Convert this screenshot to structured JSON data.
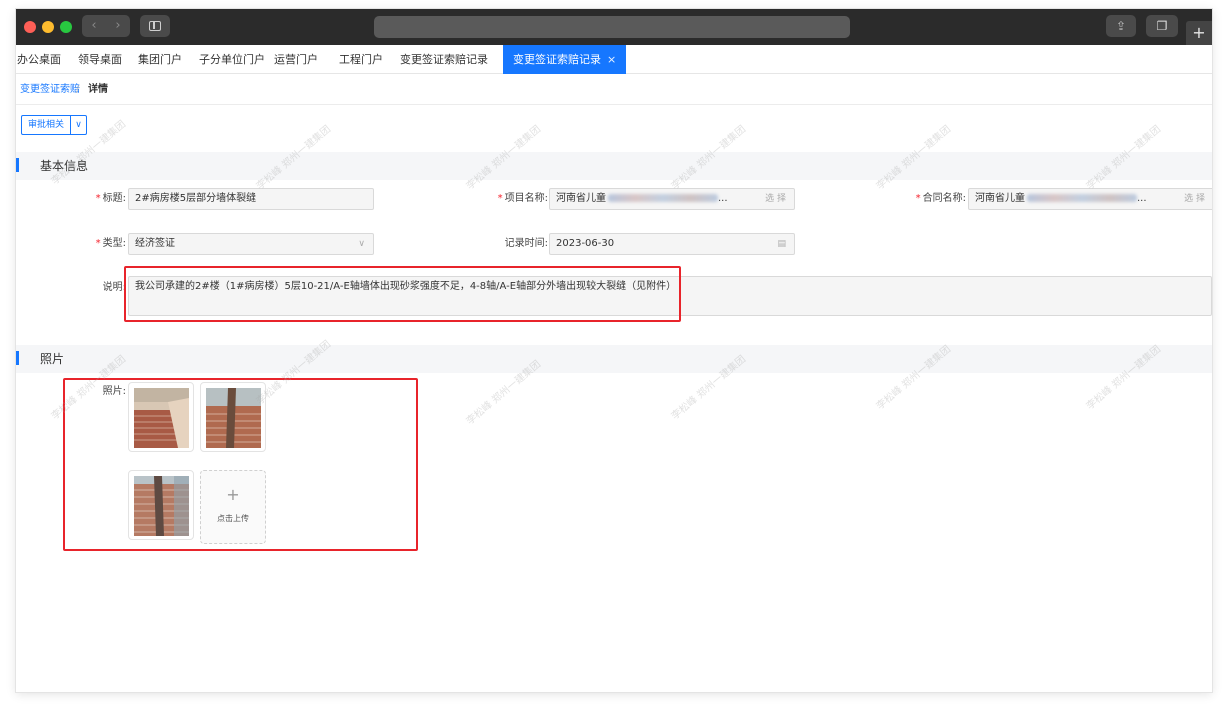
{
  "browser": {
    "nav_back": "‹",
    "nav_forward": "›",
    "share_icon": "share-icon",
    "tabs_icon": "tabs-icon",
    "new_tab": "+"
  },
  "tabs": [
    {
      "label": "办公桌面"
    },
    {
      "label": "领导桌面"
    },
    {
      "label": "集团门户"
    },
    {
      "label": "子分单位门户"
    },
    {
      "label": "运营门户"
    },
    {
      "label": "工程门户"
    },
    {
      "label": "变更签证索赔记录"
    },
    {
      "label": "变更签证索赔记录",
      "close": "×"
    }
  ],
  "breadcrumb": {
    "link": "变更签证索赔",
    "separator": "/",
    "current": "详情"
  },
  "toolbar": {
    "approve_label": "审批相关",
    "dropdown": "∨"
  },
  "basic_info": {
    "section_title": "基本信息",
    "title_label": "标题:",
    "title_value": "2#病房楼5层部分墙体裂缝",
    "project_label": "项目名称:",
    "project_value_prefix": "河南省儿童",
    "project_value_suffix": "...",
    "project_select": "选 择",
    "contract_label": "合同名称:",
    "contract_value_prefix": "河南省儿童",
    "contract_value_suffix": "...",
    "contract_select": "选 择",
    "type_label": "类型:",
    "type_value": "经济签证",
    "type_caret": "∨",
    "date_label": "记录时间:",
    "date_value": "2023-06-30",
    "calendar_icon": "calendar-icon",
    "desc_label": "说明:",
    "desc_value": "我公司承建的2#楼（1#病房楼）5层10-21/A-E轴墙体出现砂浆强度不足，4-8轴/A-E轴部分外墙出现较大裂缝（见附件）"
  },
  "photos": {
    "section_title": "照片",
    "photos_label": "照片:",
    "upload_plus": "+",
    "upload_label": "点击上传"
  },
  "watermark": "李松峰 郑州一建集团"
}
